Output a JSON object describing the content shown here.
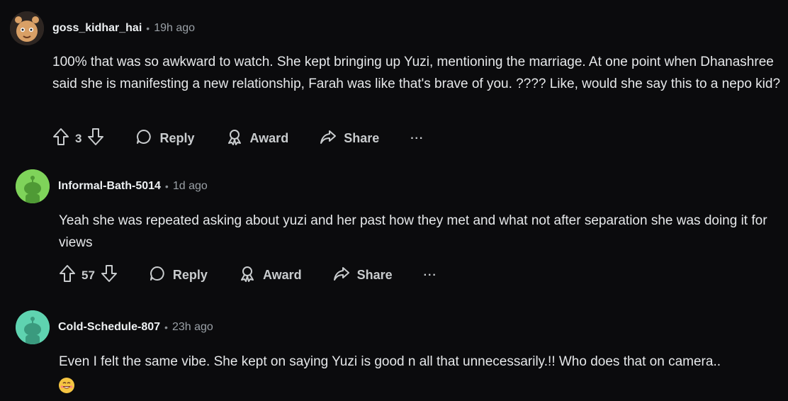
{
  "comments": [
    {
      "username": "goss_kidhar_hai",
      "separator": "•",
      "time": "19h ago",
      "text": "100% that was so awkward to watch. She kept bringing up Yuzi, mentioning the marriage. At one point when Dhanashree said she is manifesting a new relationship, Farah was like that's brave of you. ???? Like, would she say this to a nepo kid?",
      "votes": "3",
      "reply_label": "Reply",
      "award_label": "Award",
      "share_label": "Share",
      "more_label": "···"
    },
    {
      "username": "Informal-Bath-5014",
      "separator": "•",
      "time": "1d ago",
      "text": "Yeah she was repeated asking about yuzi and her past how they met and what not after separation she was doing it for views",
      "votes": "57",
      "reply_label": "Reply",
      "award_label": "Award",
      "share_label": "Share",
      "more_label": "···"
    },
    {
      "username": "Cold-Schedule-807",
      "separator": "•",
      "time": "23h ago",
      "text": "Even I felt the same vibe. She kept on saying Yuzi is good n all that unnecessarily.!! Who does that on camera.."
    }
  ],
  "colors": {
    "background": "#0b0b0d",
    "avatar_green": "#7fd35a",
    "avatar_teal": "#5fd3b0"
  }
}
